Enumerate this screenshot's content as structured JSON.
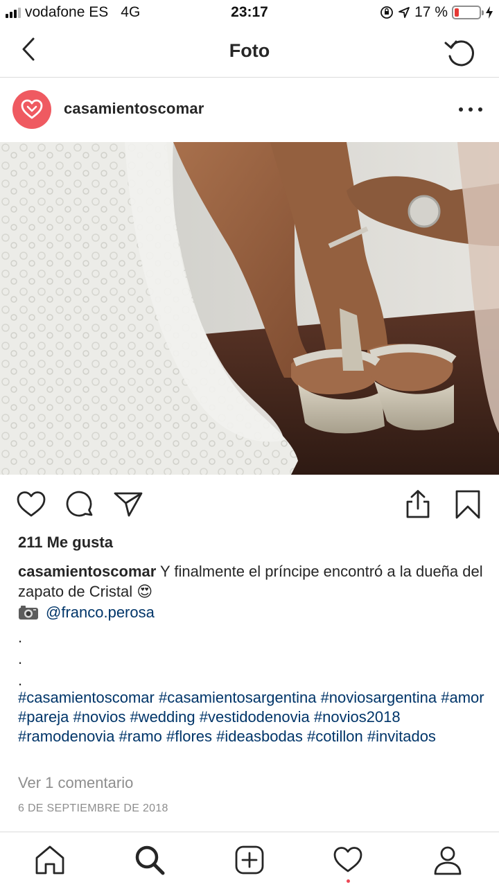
{
  "status_bar": {
    "carrier": "vodafone ES",
    "network": "4G",
    "time": "23:17",
    "battery_text": "17 %",
    "battery_level": 0.17,
    "battery_color": "#e53935"
  },
  "header": {
    "title": "Foto",
    "back_icon": "chevron-left-icon",
    "refresh_icon": "refresh-icon"
  },
  "post": {
    "username": "casamientoscomar",
    "avatar_icon": "heart-logo-icon",
    "avatar_color": "#ef5a61",
    "likes": "211 Me gusta",
    "caption_user": "casamientoscomar",
    "caption_text": " Y finalmente el príncipe encontró a la dueña del zapato de Cristal 😍",
    "mention": "@franco.perosa",
    "dots": [
      ".",
      ".",
      "."
    ],
    "hashtags": " #casamientoscomar #casamientosargentina #noviosargentina #amor #pareja #novios #wedding #vestidodenovia #novios2018 #ramodenovia #ramo #flores #ideasbodas #cotillon #invitados",
    "view_comments": "Ver 1 comentario",
    "date": "6 DE SEPTIEMBRE DE 2018",
    "link_color": "#003569"
  },
  "actions": [
    "heart-icon",
    "comment-icon",
    "share-icon",
    "upload-icon",
    "bookmark-icon"
  ],
  "tabs": [
    "home-icon",
    "search-icon",
    "add-post-icon",
    "activity-heart-icon",
    "profile-icon"
  ]
}
